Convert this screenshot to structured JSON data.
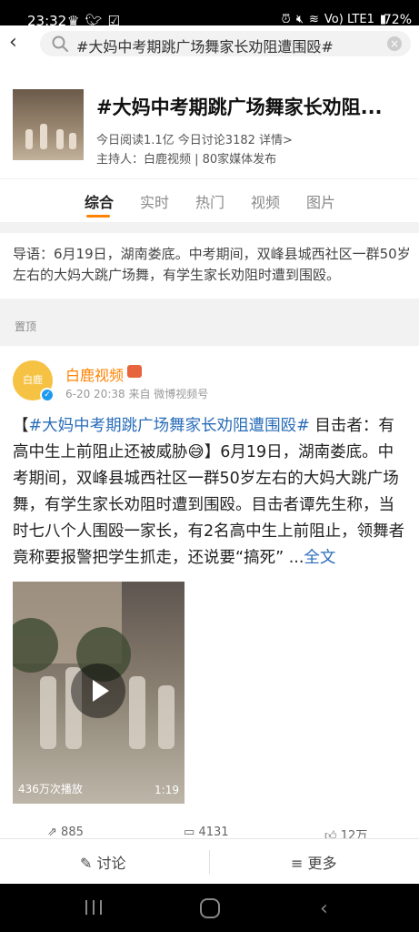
{
  "status_bar": {
    "time": "23:32",
    "left_icons": [
      "crown-icon",
      "twitter-icon",
      "check-box-icon"
    ],
    "right_icons_text": "Vo) LTE1",
    "battery": "72%"
  },
  "search": {
    "query": "#大妈中考期跳广场舞家长劝阻遭围殴#"
  },
  "topic": {
    "title": "#大妈中考期跳广场舞家长劝阻...",
    "stats": "今日阅读1.1亿 今日讨论3182 详情>",
    "host": "主持人：白鹿视频 | 80家媒体发布"
  },
  "tabs": [
    {
      "label": "综合",
      "active": true
    },
    {
      "label": "实时",
      "active": false
    },
    {
      "label": "热门",
      "active": false
    },
    {
      "label": "视频",
      "active": false
    },
    {
      "label": "图片",
      "active": false
    }
  ],
  "intro": {
    "text": "导语：6月19日，湖南娄底。中考期间，双峰县城西社区一群50岁左右的大妈大跳广场舞，有学生家长劝阻时遭到围殴。"
  },
  "pinned_label": "置顶",
  "post": {
    "avatar_text": "白鹿",
    "author": "白鹿视频",
    "meta": "6-20 20:38 来自 微博视频号",
    "text_open": "【",
    "hashtag": "#大妈中考期跳广场舞家长劝阻遭围殴#",
    "text_body": " 目击者：有高中生上前阻止还被威胁😅】6月19日，湖南娄底。中考期间，双峰县城西社区一群50岁左右的大妈大跳广场舞，有学生家长劝阻时遭到围殴。目击者谭先生称，当时七八个人围殴一家长，有2名高中生上前阻止，领舞者竟称要报警把学生抓走，还说要“搞死” ...",
    "more": "全文",
    "video": {
      "views": "436万次播放",
      "duration": "1:19"
    },
    "actions": {
      "repost": "885",
      "comment": "4131",
      "like": "12万"
    }
  },
  "bottom_bar": {
    "discuss": "讨论",
    "more": "更多"
  },
  "colors": {
    "accent": "#ff8200",
    "link": "#2a6db9",
    "background_gap": "#f2f2f2"
  }
}
